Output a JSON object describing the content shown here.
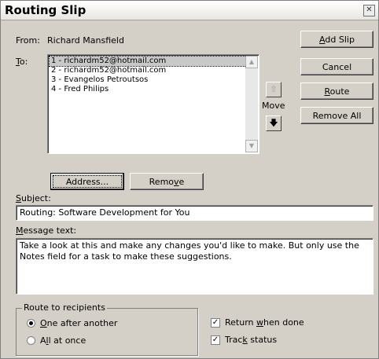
{
  "window": {
    "title": "Routing Slip",
    "close_icon": "close-icon"
  },
  "from": {
    "label": "From:",
    "value": "Richard Mansfield"
  },
  "to": {
    "label": "To:",
    "recipients": [
      "1 - richardm52@hotmail.com",
      "2 - richardm52@hotmail.com",
      "3 - Evangelos Petroutsos",
      "4 - Fred Philips"
    ],
    "selected_index": 0
  },
  "move": {
    "label": "Move",
    "up_icon": "arrow-up-icon",
    "down_icon": "arrow-down-icon"
  },
  "buttons": {
    "add_slip": "Add Slip",
    "cancel": "Cancel",
    "route": "Route",
    "remove_all": "Remove All",
    "address": "Address...",
    "remove": "Remove"
  },
  "subject": {
    "label": "Subject:",
    "value": "Routing: Software Development for You"
  },
  "message": {
    "label": "Message text:",
    "value": "Take a look at this and make any changes you'd like to make. But only use the Notes field for a task to make these suggestions."
  },
  "route_to_recipients": {
    "label": "Route to recipients",
    "options": [
      "One after another",
      "All at once"
    ],
    "selected": "One after another"
  },
  "options": {
    "return_when_done": {
      "label": "Return when done",
      "checked": true
    },
    "track_status": {
      "label": "Track status",
      "checked": true
    }
  }
}
